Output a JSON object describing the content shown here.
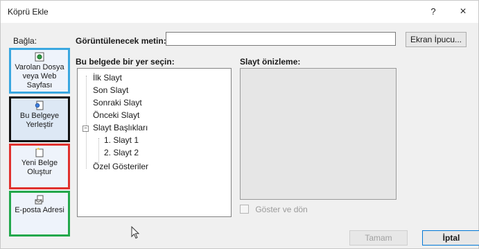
{
  "window": {
    "title": "Köprü Ekle",
    "help": "?",
    "close": "×"
  },
  "link_to": {
    "label": "Bağla:",
    "items": [
      {
        "label": "Varolan Dosya veya Web Sayfası",
        "icon": "existing-file-icon"
      },
      {
        "label": "Bu Belgeye Yerleştir",
        "icon": "place-in-document-icon"
      },
      {
        "label": "Yeni Belge Oluştur",
        "icon": "new-document-icon"
      },
      {
        "label": "E-posta Adresi",
        "icon": "email-address-icon"
      }
    ]
  },
  "display_text": {
    "label": "Görüntülenecek metin:",
    "value": "",
    "placeholder": ""
  },
  "screen_tip_button": "Ekran İpucu...",
  "place_select": {
    "label": "Bu belgede bir yer seçin:",
    "items": {
      "first": "İlk Slayt",
      "last": "Son Slayt",
      "next": "Sonraki Slayt",
      "prev": "Önceki Slayt",
      "titles": "Slayt Başlıkları",
      "slide1": "1. Slayt 1",
      "slide2": "2. Slayt 2",
      "custom": "Özel Gösteriler"
    }
  },
  "slide_preview": {
    "label": "Slayt önizleme:"
  },
  "show_and_return": {
    "label": "Göster ve dön",
    "checked": false
  },
  "buttons": {
    "ok": "Tamam",
    "cancel": "İptal"
  }
}
